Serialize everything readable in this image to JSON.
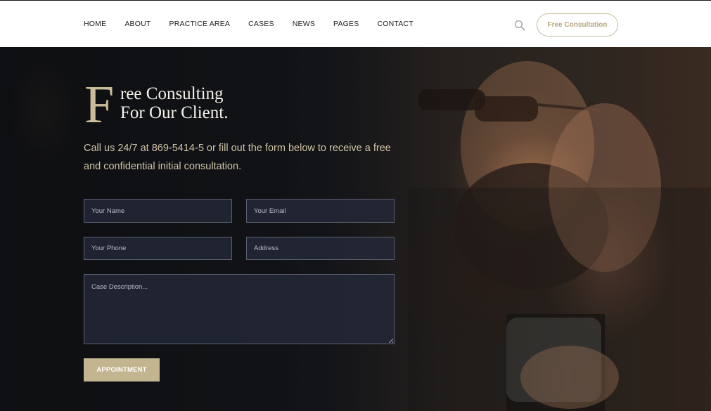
{
  "nav": {
    "items": [
      "HOME",
      "ABOUT",
      "PRACTICE AREA",
      "CASES",
      "NEWS",
      "PAGES",
      "CONTACT"
    ],
    "consult_label": "Free Consultation",
    "search_icon": "search-icon"
  },
  "hero": {
    "dropcap": "F",
    "title_line1": "ree Consulting",
    "title_line2": "For Our Client.",
    "intro": "Call us 24/7 at 869-5414-5 or fill out the form below to receive a free and confidential initial consultation.",
    "form": {
      "name_placeholder": "Your Name",
      "email_placeholder": "Your Email",
      "phone_placeholder": "Your Phone",
      "address_placeholder": "Address",
      "description_placeholder": "Case Description...",
      "submit_label": "APPOINTMENT"
    }
  },
  "colors": {
    "accent": "#c2b590",
    "nav_text": "#1d1d1d",
    "intro_text": "#cfc3a5"
  }
}
